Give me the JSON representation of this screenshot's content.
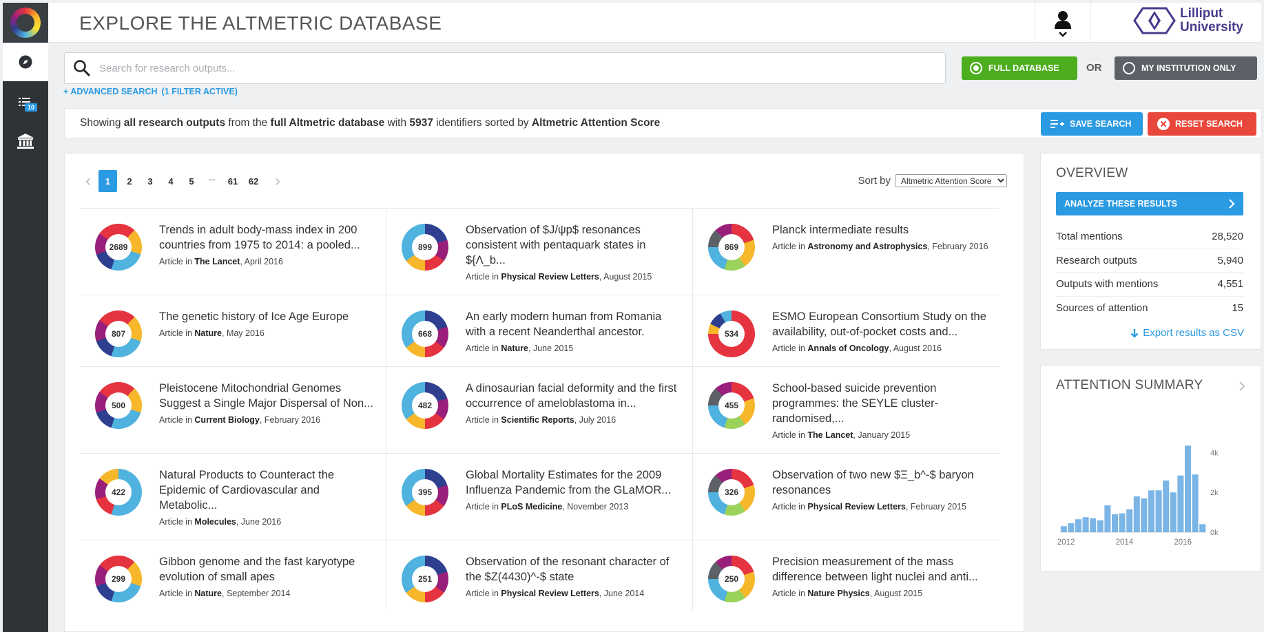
{
  "header": {
    "title": "EXPLORE THE ALTMETRIC DATABASE",
    "institution_line1": "Lilliput",
    "institution_line2": "University"
  },
  "sidebar": {
    "badge_count": "10"
  },
  "search": {
    "placeholder": "Search for research outputs...",
    "value": "",
    "advanced_label": "+ ADVANCED SEARCH",
    "filter_label": "(1 FILTER ACTIVE)",
    "full_db_label": "FULL DATABASE",
    "or_label": "OR",
    "institution_label": "MY INSTITUTION ONLY"
  },
  "summary": {
    "t1": "Showing ",
    "b1": "all research outputs",
    "t2": " from the ",
    "b2": "full Altmetric database",
    "t3": " with ",
    "b3": "5937",
    "t4": " identifiers sorted by ",
    "b4": "Altmetric Attention Score",
    "save_label": "SAVE SEARCH",
    "reset_label": "RESET SEARCH"
  },
  "pagination": {
    "pages": [
      "1",
      "2",
      "3",
      "4",
      "5",
      "...",
      "61",
      "62"
    ],
    "current": "1"
  },
  "sort": {
    "label": "Sort by",
    "selected": "Altmetric Attention Score"
  },
  "results": [
    {
      "score": "2689",
      "title": "Trends in adult body-mass index in 200 countries from 1975 to 2014: a pooled...",
      "type": "Article in ",
      "journal": "The Lancet",
      "date": ", April 2016"
    },
    {
      "score": "899",
      "title": "Observation of $J/ψp$ resonances consistent with pentaquark states in ${Λ_b...",
      "type": "Article in ",
      "journal": "Physical Review Letters",
      "date": ", August 2015"
    },
    {
      "score": "869",
      "title": "Planck intermediate results",
      "type": "Article in ",
      "journal": "Astronomy and Astrophysics",
      "date": ", February 2016"
    },
    {
      "score": "807",
      "title": "The genetic history of Ice Age Europe",
      "type": "Article in ",
      "journal": "Nature",
      "date": ", May 2016"
    },
    {
      "score": "668",
      "title": "An early modern human from Romania with a recent Neanderthal ancestor.",
      "type": "Article in ",
      "journal": "Nature",
      "date": ", June 2015"
    },
    {
      "score": "534",
      "title": "ESMO European Consortium Study on the availability, out-of-pocket costs and...",
      "type": "Article in ",
      "journal": "Annals of Oncology",
      "date": ", August 2016"
    },
    {
      "score": "500",
      "title": "Pleistocene Mitochondrial Genomes Suggest a Single Major Dispersal of Non...",
      "type": "Article in ",
      "journal": "Current Biology",
      "date": ", February 2016"
    },
    {
      "score": "482",
      "title": "A dinosaurian facial deformity and the first occurrence of ameloblastoma in...",
      "type": "Article in ",
      "journal": "Scientific Reports",
      "date": ", July 2016"
    },
    {
      "score": "455",
      "title": "School-based suicide prevention programmes: the SEYLE cluster-randomised,...",
      "type": "Article in ",
      "journal": "The Lancet",
      "date": ", January 2015"
    },
    {
      "score": "422",
      "title": "Natural Products to Counteract the Epidemic of Cardiovascular and Metabolic...",
      "type": "Article in ",
      "journal": "Molecules",
      "date": ", June 2016"
    },
    {
      "score": "395",
      "title": "Global Mortality Estimates for the 2009 Influenza Pandemic from the GLaMOR...",
      "type": "Article in ",
      "journal": "PLoS Medicine",
      "date": ", November 2013"
    },
    {
      "score": "326",
      "title": "Observation of two new $Ξ_b^-$ baryon resonances",
      "type": "Article in ",
      "journal": "Physical Review Letters",
      "date": ", February 2015"
    },
    {
      "score": "299",
      "title": "Gibbon genome and the fast karyotype evolution of small apes",
      "type": "Article in ",
      "journal": "Nature",
      "date": ", September 2014"
    },
    {
      "score": "251",
      "title": "Observation of the resonant character of the $Z(4430)^-$ state",
      "type": "Article in ",
      "journal": "Physical Review Letters",
      "date": ", June 2014"
    },
    {
      "score": "250",
      "title": "Precision measurement of the mass difference between light nuclei and anti...",
      "type": "Article in ",
      "journal": "Nature Physics",
      "date": ", August 2015"
    }
  ],
  "overview": {
    "title": "OVERVIEW",
    "analyze_label": "ANALYZE THESE RESULTS",
    "stats": [
      {
        "label": "Total mentions",
        "value": "28,520"
      },
      {
        "label": "Research outputs",
        "value": "5,940"
      },
      {
        "label": "Outputs with mentions",
        "value": "4,551"
      },
      {
        "label": "Sources of attention",
        "value": "15"
      }
    ],
    "export_label": "Export results as CSV"
  },
  "attention": {
    "title": "ATTENTION SUMMARY"
  },
  "colors": {
    "accent_blue": "#2a9ae3",
    "green": "#4cad1e",
    "gray_btn": "#5b6167",
    "red": "#e8483b",
    "bar_blue": "#7ab5e6",
    "sidebar": "#2f3337"
  },
  "chart_data": {
    "type": "bar",
    "title": "",
    "xlabel": "",
    "ylabel": "",
    "x_tick_labels": [
      "2012",
      "2014",
      "2016"
    ],
    "y_tick_labels": [
      "0k",
      "2k",
      "4k"
    ],
    "ylim": [
      0,
      4500
    ],
    "grid": false,
    "x": [
      "2011 Q4",
      "2012 Q1",
      "2012 Q2",
      "2012 Q3",
      "2012 Q4",
      "2013 Q1",
      "2013 Q2",
      "2013 Q3",
      "2013 Q4",
      "2014 Q1",
      "2014 Q2",
      "2014 Q3",
      "2014 Q4",
      "2015 Q1",
      "2015 Q2",
      "2015 Q3",
      "2015 Q4",
      "2016 Q1",
      "2016 Q2",
      "2016 Q3"
    ],
    "values": [
      300,
      450,
      650,
      750,
      700,
      600,
      1350,
      900,
      950,
      1150,
      1800,
      1700,
      2100,
      2100,
      2600,
      2000,
      2850,
      4350,
      2900,
      400
    ]
  }
}
